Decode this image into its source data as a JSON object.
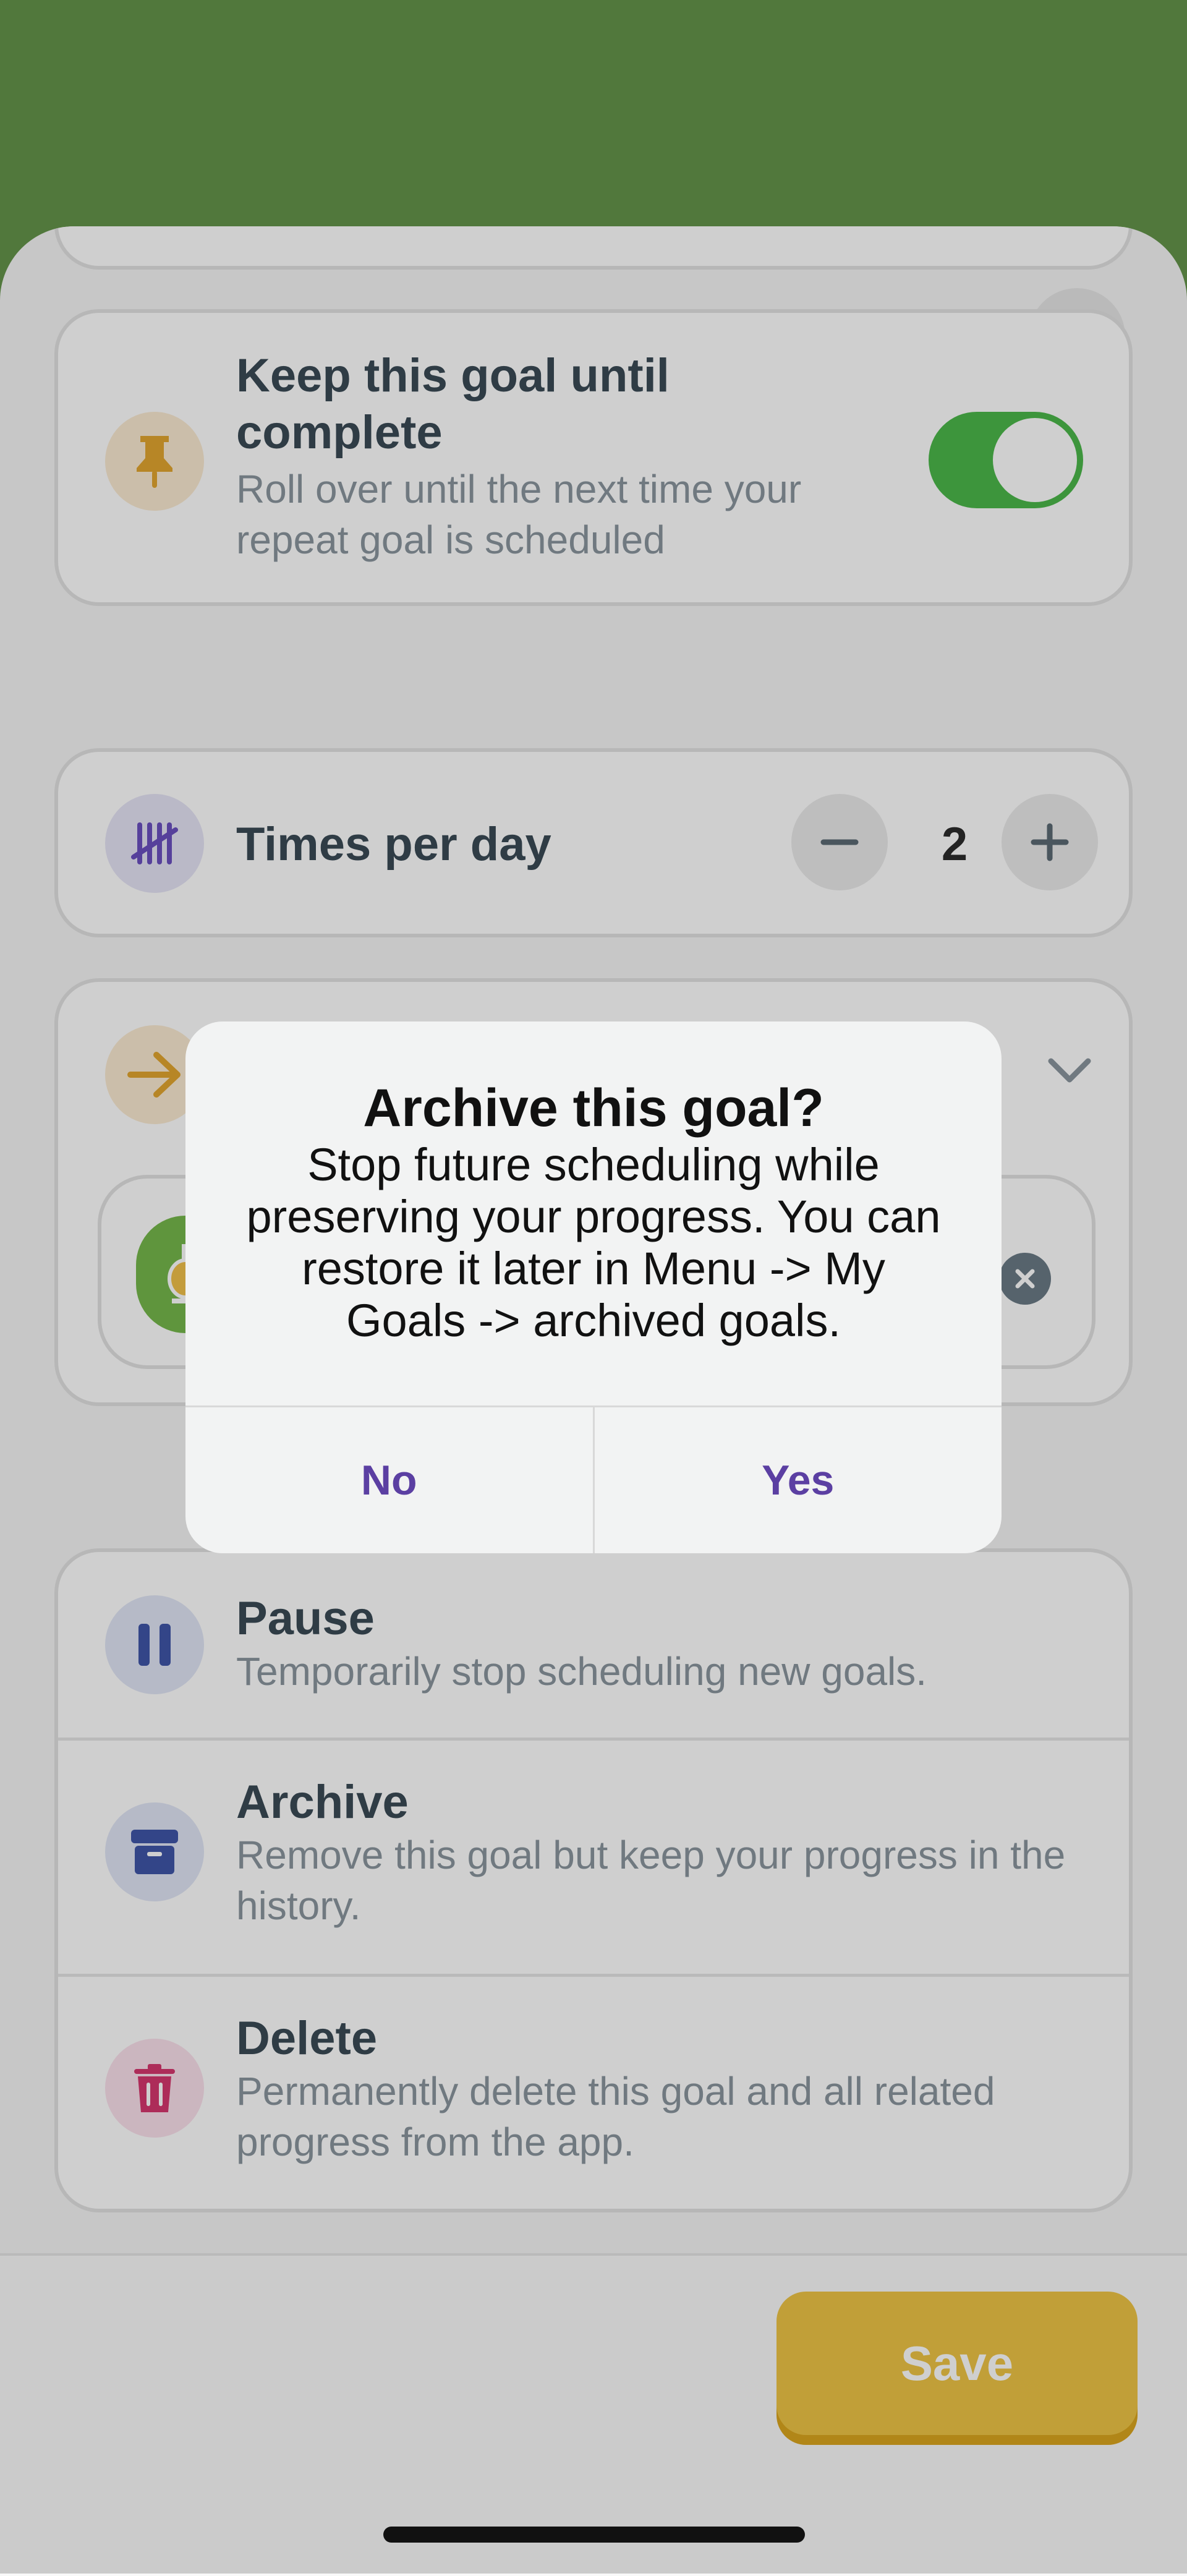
{
  "keep_goal": {
    "title": "Keep this goal until complete",
    "subtitle": "Roll over until the next time your repeat goal is scheduled",
    "toggle_on": true
  },
  "times_per_day": {
    "label": "Times per day",
    "value": "2"
  },
  "actions": [
    {
      "title": "Pause",
      "subtitle": "Temporarily stop scheduling new goals."
    },
    {
      "title": "Archive",
      "subtitle": "Remove this goal but keep your progress in the history."
    },
    {
      "title": "Delete",
      "subtitle": "Permanently delete this goal and all related progress from the app."
    }
  ],
  "footer": {
    "save_label": "Save"
  },
  "dialog": {
    "title": "Archive this goal?",
    "body": "Stop future scheduling while preserving your progress. You can restore it later in Menu -> My Goals -> archived goals.",
    "no_label": "No",
    "yes_label": "Yes"
  },
  "colors": {
    "header_green": "#64944a",
    "toggle_green": "#4cb84a",
    "accent_purple": "#5b3fa2",
    "save_yellow": "#eec445"
  },
  "icons": {
    "close": "close-icon",
    "pin": "pin-icon",
    "tally": "tally-icon",
    "arrow": "arrow-right-icon",
    "pause": "pause-icon",
    "archive": "archive-box-icon",
    "delete": "trash-icon"
  }
}
